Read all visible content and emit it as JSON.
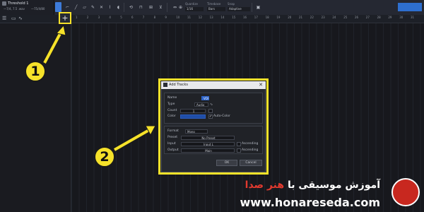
{
  "project": {
    "name": "Threshold 1",
    "subtitle": "—7/4, 7.5 .wav",
    "tempo": "—75/4/80"
  },
  "toolbar": {
    "quantize_label": "Quantize",
    "quantize_value": "1/16",
    "timebase_label": "Timebase",
    "timebase_value": "Bars",
    "snap_label": "Snap",
    "snap_value": "Adaptive",
    "icons": [
      "arrow-tool-icon",
      "range-tool-icon",
      "split-tool-icon",
      "eraser-tool-icon",
      "paint-tool-icon",
      "mute-tool-icon",
      "bend-tool-icon",
      "listen-tool-icon",
      "loop-icon",
      "snap-icon",
      "grid-icon",
      "metronome-icon",
      "autoscroll-icon",
      "zoom-icon"
    ]
  },
  "ruler": {
    "marks": [
      "1",
      "2",
      "3",
      "4",
      "5",
      "6",
      "7",
      "8",
      "9",
      "10",
      "11",
      "12",
      "13",
      "14",
      "15",
      "16",
      "17",
      "18",
      "19",
      "20",
      "21",
      "22",
      "23",
      "24",
      "25",
      "26",
      "27",
      "28",
      "29",
      "30",
      "31"
    ]
  },
  "add_track_button": {
    "label": "+"
  },
  "callouts": {
    "one": "1",
    "two": "2"
  },
  "dialog": {
    "title": "Add Tracks",
    "name_label": "Name",
    "name_value": "VOX",
    "type_label": "Type",
    "type_value": "Audio",
    "count_label": "Count",
    "count_value": "1",
    "color_label": "Color",
    "auto_color_label": "Auto-Color",
    "format_label": "Format",
    "format_value": "Mono",
    "preset_label": "Preset",
    "preset_value": "No Preset",
    "input_label": "Input",
    "input_value": "Input L",
    "input_ascending": "Ascending",
    "output_label": "Output",
    "output_value": "Main",
    "output_ascending": "Ascending",
    "ok_label": "OK",
    "cancel_label": "Cancel"
  },
  "watermark": {
    "title_prefix": "آموزش موسیقی با",
    "title_brand": "هنر صدا",
    "url": "www.honareseda.com"
  },
  "colors": {
    "accent_yellow": "#f6e22a",
    "toolbar_blue": "#3d7bd9",
    "brand_red": "#e13a2f"
  }
}
